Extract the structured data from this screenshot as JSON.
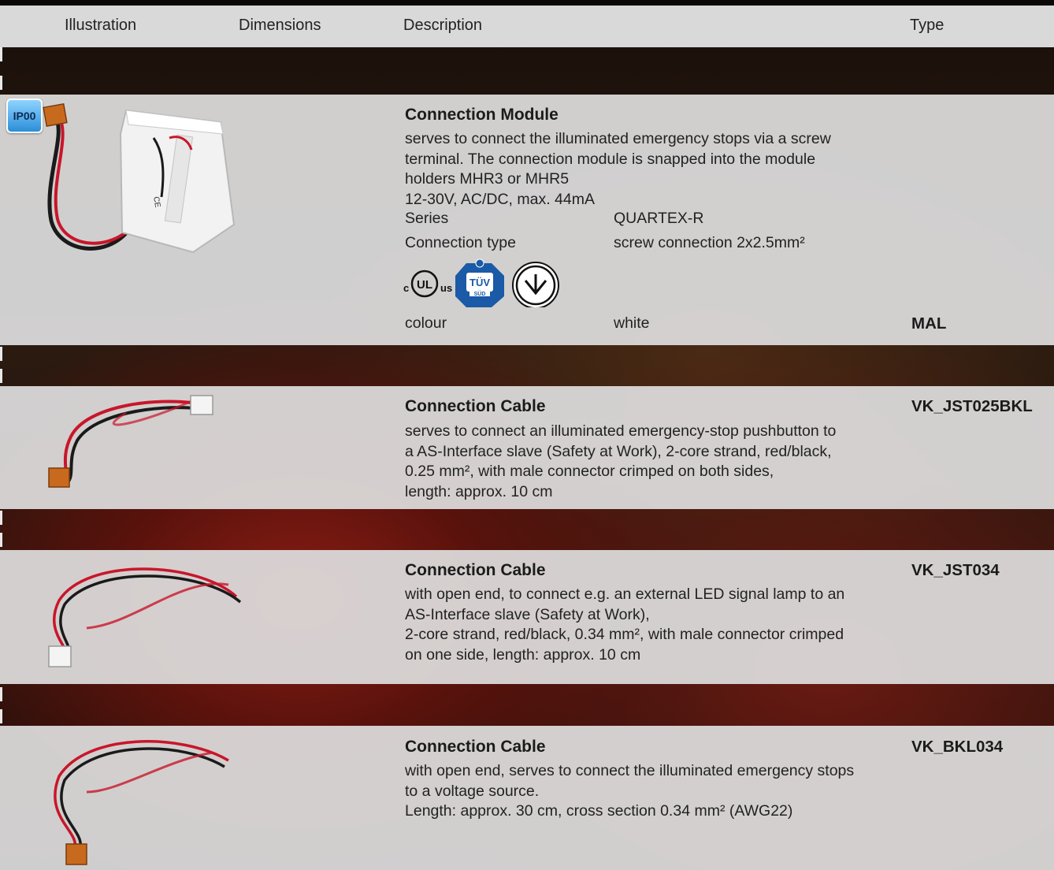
{
  "header": {
    "illustration": "Illustration",
    "dimensions": "Dimensions",
    "description": "Description",
    "type": "Type"
  },
  "products": [
    {
      "badge": "IP00",
      "title": "Connection Module",
      "desc_lines": [
        "serves to connect the illuminated emergency stops via a screw",
        "terminal. The connection module is snapped into the module",
        "holders MHR3 or MHR5",
        "12-30V, AC/DC, max. 44mA"
      ],
      "series_label": "Series",
      "series_value": "QUARTEX-R",
      "conn_label": "Connection type",
      "conn_value": "screw connection 2x2.5mm²",
      "colour_label": "colour",
      "colour_value": "white",
      "type": "MAL",
      "cert_ul_c": "c",
      "cert_ul_text": "UL",
      "cert_ul_us": "us",
      "cert_tuv_text": "TÜV",
      "cert_tuv_sub": "SÜD"
    },
    {
      "title": "Connection Cable",
      "desc_lines": [
        "serves to connect an illuminated emergency-stop pushbutton to",
        "a AS-Interface slave (Safety at Work), 2-core strand, red/black,",
        "0.25 mm², with male connector crimped on both sides,",
        "length: approx. 10 cm"
      ],
      "type": "VK_JST025BKL"
    },
    {
      "title": "Connection Cable",
      "desc_lines": [
        "with open end, to connect e.g. an external LED signal lamp to an",
        "AS-Interface slave (Safety at Work),",
        "2-core strand, red/black, 0.34 mm², with male connector crimped",
        "on one side, length: approx. 10 cm"
      ],
      "type": "VK_JST034"
    },
    {
      "title": "Connection Cable",
      "desc_lines": [
        "with open end, serves to connect the illuminated emergency stops",
        "to a voltage source.",
        "Length: approx. 30 cm, cross section 0.34 mm² (AWG22)"
      ],
      "type": "VK_BKL034"
    }
  ],
  "colors": {
    "panel": "#dedede",
    "badge": "#2b8fd8",
    "cable_red": "#d0172a",
    "cable_black": "#1a1a1a",
    "connector": "#c86a1e"
  }
}
